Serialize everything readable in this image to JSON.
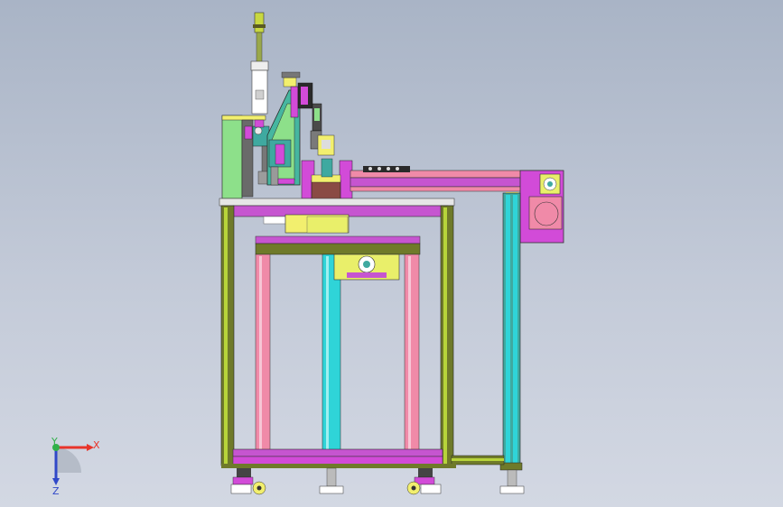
{
  "viewport": {
    "background_top": "#a9b4c6",
    "background_bottom": "#d3d8e3"
  },
  "triad": {
    "x_label": "X",
    "y_label": "Y",
    "z_label": "Z",
    "x_color": "#e8342a",
    "y_color": "#2fb04a",
    "z_color": "#3048c8"
  },
  "model": {
    "frame_colors": {
      "olive": "#6f7a2a",
      "lime": "#b7d43a",
      "magenta": "#d24bd8",
      "pink": "#f08aa8",
      "cyan": "#2fd4d8",
      "green_plate": "#8de08a",
      "teal_post": "#3fa9a0",
      "yellow_plate": "#f2ef6e",
      "purple_rail": "#c655d0",
      "brown_block": "#8a4a44",
      "motor_yellow": "#e9ef6a",
      "grey": "#b9b9b9"
    }
  }
}
